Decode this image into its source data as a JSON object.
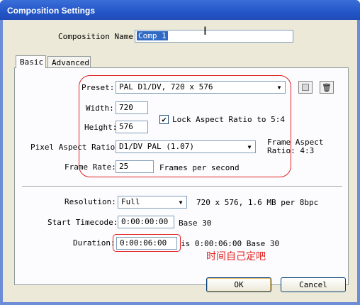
{
  "window": {
    "title": "Composition Settings"
  },
  "comp_name": {
    "label": "Composition Name:",
    "value": "Comp 1"
  },
  "tabs": [
    {
      "label": "Basic"
    },
    {
      "label": "Advanced"
    }
  ],
  "preset": {
    "label": "Preset:",
    "value": "PAL D1/DV, 720 x 576"
  },
  "width": {
    "label": "Width:",
    "value": "720"
  },
  "height": {
    "label": "Height:",
    "value": "576"
  },
  "lock_aspect": {
    "label": "Lock Aspect Ratio to 5:4",
    "checked": true
  },
  "pixel_aspect": {
    "label": "Pixel Aspect Ratio:",
    "value": "D1/DV PAL (1.07)"
  },
  "frame_aspect": {
    "line1": "Frame Aspect",
    "line2": "Ratio: 4:3"
  },
  "frame_rate": {
    "label": "Frame Rate:",
    "value": "25",
    "suffix": "Frames per second"
  },
  "resolution": {
    "label": "Resolution:",
    "value": "Full",
    "info": "720 x 576, 1.6 MB per 8bpc"
  },
  "start_timecode": {
    "label": "Start Timecode:",
    "value": "0:00:00:00",
    "base": "Base 30"
  },
  "duration": {
    "label": "Duration:",
    "value": "0:00:06:00",
    "info": "is 0:00:06:00  Base 30"
  },
  "annotation": "时间自己定吧",
  "buttons": {
    "ok": "OK",
    "cancel": "Cancel"
  },
  "colors": {
    "annotation": "#e02020",
    "titlebar": "#2456c8"
  },
  "icons": {
    "save": "disk-icon",
    "delete": "trash-icon"
  }
}
